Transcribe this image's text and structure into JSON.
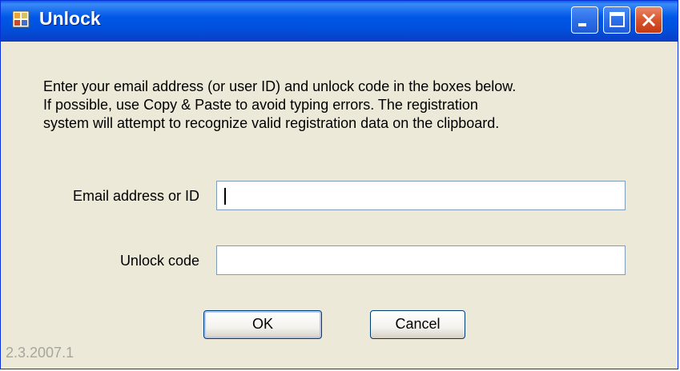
{
  "window": {
    "title": "Unlock",
    "title_color": "#ffffff",
    "titlebar_color": "#0054e3",
    "background_color": "#ece9d8",
    "controls": [
      "minimize-icon",
      "maximize-icon",
      "close-icon"
    ]
  },
  "instructions": {
    "lines": [
      "Enter your email address (or user ID) and unlock code in the boxes below.",
      "If possible, use Copy & Paste to avoid typing errors. The registration",
      "system will attempt to recognize valid registration data on the clipboard."
    ]
  },
  "form": {
    "email_label": "Email address or ID",
    "email_value": "",
    "unlock_label": "Unlock code",
    "unlock_value": ""
  },
  "buttons": {
    "ok_label": "OK",
    "cancel_label": "Cancel"
  },
  "footer": {
    "version": "2.3.2007.1"
  }
}
